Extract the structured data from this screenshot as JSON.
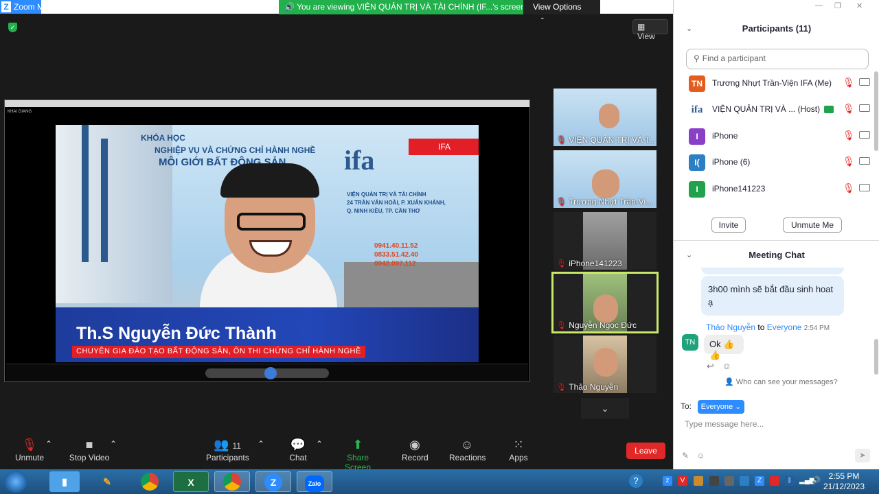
{
  "window": {
    "title": "Zoom Meeting",
    "ghost_title": "",
    "share_banner": "You are viewing VIỆN QUẢN TRỊ VÀ TÀI CHÍNH (IF...'s screen",
    "view_options": "View Options",
    "view_button": "View"
  },
  "slide": {
    "course": "KHÓA HỌC",
    "line1": "NGHIỆP VỤ VÀ CHỨNG CHỈ HÀNH NGHỀ",
    "line2": "MÔI GIỚI BẤT ĐỘNG SẢN",
    "logo": "ifa",
    "org": "VIỆN QUẢN TRỊ VÀ TÀI CHÍNH",
    "address1": "24 TRẦN VĂN HOÀI, P. XUÂN KHÁNH,",
    "address2": "Q. NINH KIỀU, TP. CẦN THƠ",
    "phones": [
      "0941.40.11.52",
      "0833.51.42.40",
      "0942.097.112"
    ],
    "red_tag": "IFA",
    "presenter_name": "Th.S Nguyễn Đức Thành",
    "presenter_title": "CHUYÊN GIA ĐÀO TẠO BẤT ĐỘNG SẢN, ÔN THI CHỨNG CHỈ HÀNH NGHỀ",
    "share_label": "KHAI GIANG"
  },
  "thumbnails": [
    {
      "label": "VIỆN QUẢN TRỊ VÀ T...",
      "type": "slide"
    },
    {
      "label": "Trương Nhựt Trần-Vi...",
      "type": "slide"
    },
    {
      "label": "iPhone141223",
      "type": "cam"
    },
    {
      "label": "Nguyễn Ngọc Đức",
      "type": "cam",
      "active": true
    },
    {
      "label": "Thảo Nguyễn",
      "type": "cam"
    }
  ],
  "toolbar": {
    "unmute": "Unmute",
    "stop_video": "Stop Video",
    "participants": "Participants",
    "participants_count": "11",
    "chat": "Chat",
    "share_screen": "Share Screen",
    "record": "Record",
    "reactions": "Reactions",
    "apps": "Apps",
    "leave": "Leave"
  },
  "participants_panel": {
    "title": "Participants (11)",
    "search_placeholder": "Find a participant",
    "rows": [
      {
        "initials": "TN",
        "name": "Trương Nhựt Trần-Viện IFA (Me)",
        "color": "#e55d1e"
      },
      {
        "initials": "ifa",
        "name": "VIỆN QUẢN TRỊ VÀ ... (Host)",
        "color": "#ffffff"
      },
      {
        "initials": "I",
        "name": "iPhone",
        "color": "#8a3fc9"
      },
      {
        "initials": "I(",
        "name": "iPhone (6)",
        "color": "#2d7fc4"
      },
      {
        "initials": "I",
        "name": "iPhone141223",
        "color": "#21a34e"
      }
    ],
    "invite": "Invite",
    "unmute_me": "Unmute Me"
  },
  "chat_panel": {
    "title": "Meeting Chat",
    "message1": "3h00 mình sẽ bắt đầu sinh hoat ạ",
    "sender": "Thảo Nguyễn",
    "to_word": "to",
    "recipient": "Everyone",
    "time": "2:54 PM",
    "sender_initials": "TN",
    "message2": "Ok 👍👍",
    "who_can_see": "Who can see your messages?",
    "to_label": "To:",
    "to_value": "Everyone",
    "input_placeholder": "Type message here..."
  },
  "taskbar": {
    "time": "2:55 PM",
    "date": "21/12/2023",
    "apps": [
      "files",
      "paint",
      "chrome",
      "excel",
      "chrome-ifa",
      "zoom",
      "zalo"
    ]
  }
}
